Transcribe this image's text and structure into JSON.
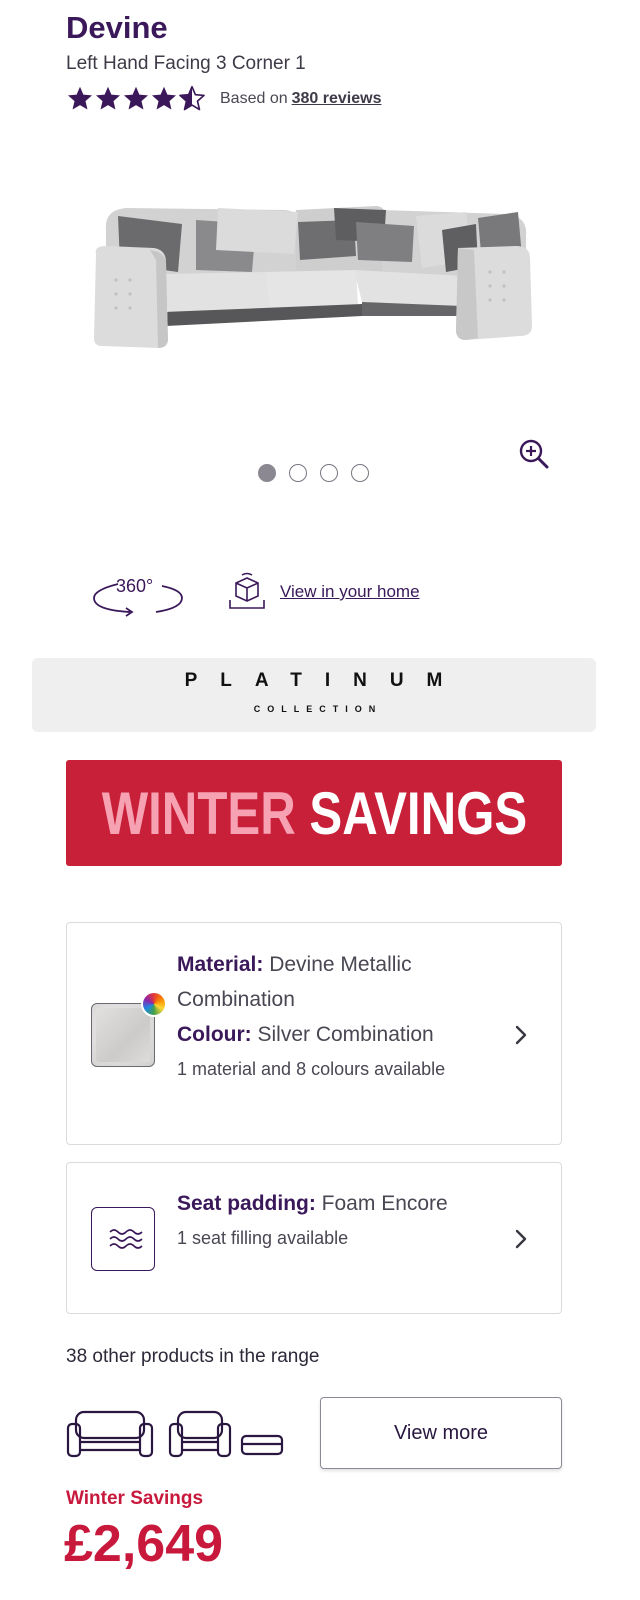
{
  "product": {
    "title": "Devine",
    "subtitle": "Left Hand Facing 3 Corner 1",
    "rating": 4.5,
    "rating_max": 5,
    "based_on_label": "Based on",
    "reviews_link": "380 reviews"
  },
  "gallery": {
    "image_icon": "corner-sofa-image",
    "zoom_icon": "zoom-in-icon",
    "slide_count": 4,
    "active_slide": 1
  },
  "viewer": {
    "rotate_label": "360°",
    "view_in_home_label": "View in your home"
  },
  "platinum_banner": {
    "title": "PLATINUM",
    "subtitle": "COLLECTION"
  },
  "promo_banner": {
    "word1": "WINTER",
    "word2": "SAVINGS",
    "background": "#c82039",
    "word1_color": "#f6a2b3"
  },
  "material_card": {
    "material_label": "Material:",
    "material_value": " Devine Metallic Combination",
    "colour_label": "Colour:",
    "colour_value": " Silver Combination",
    "note": "1 material and 8 colours available"
  },
  "seat_card": {
    "label": "Seat padding:",
    "value": " Foam Encore",
    "note": "1 seat filling available"
  },
  "range": {
    "text": "38 other products in the range",
    "icons": [
      "sofa-icon",
      "armchair-icon",
      "footstool-icon"
    ],
    "view_more_label": "View more"
  },
  "price": {
    "label": "Winter Savings",
    "value": "£2,649",
    "color": "#c8183c"
  },
  "colors": {
    "brand_purple": "#3a1859"
  }
}
